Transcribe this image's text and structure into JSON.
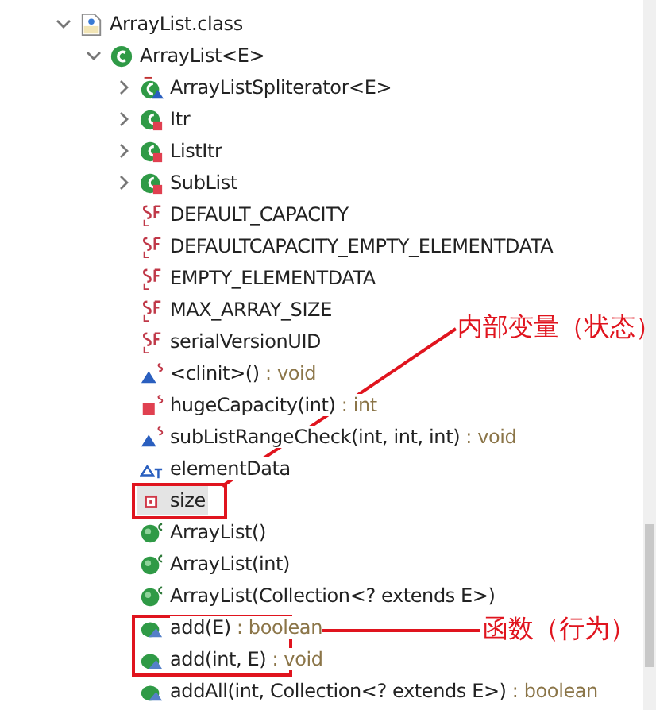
{
  "tree": [
    {
      "label": "ArrayList.class",
      "kind": "classfile",
      "expanded": true,
      "selected": false,
      "children": [
        {
          "label": "ArrayList<E>",
          "kind": "class",
          "expanded": true,
          "selected": false,
          "children": [
            {
              "label": "ArrayListSpliterator<E>",
              "kind": "static-class",
              "expanded": false,
              "selected": false
            },
            {
              "label": "Itr",
              "kind": "private-class",
              "expanded": false,
              "selected": false
            },
            {
              "label": "ListItr",
              "kind": "private-class",
              "expanded": false,
              "selected": false
            },
            {
              "label": "SubList",
              "kind": "private-class",
              "expanded": false,
              "selected": false
            },
            {
              "label": "DEFAULT_CAPACITY",
              "kind": "constant",
              "selected": false
            },
            {
              "label": "DEFAULTCAPACITY_EMPTY_ELEMENTDATA",
              "kind": "constant",
              "selected": false
            },
            {
              "label": "EMPTY_ELEMENTDATA",
              "kind": "constant",
              "selected": false
            },
            {
              "label": "MAX_ARRAY_SIZE",
              "kind": "constant",
              "selected": false
            },
            {
              "label": "serialVersionUID",
              "kind": "constant",
              "selected": false
            },
            {
              "label": "<clinit>()",
              "type": " : void",
              "kind": "static-method",
              "selected": false
            },
            {
              "label": "hugeCapacity(int)",
              "type": " : int",
              "kind": "static-private-method",
              "selected": false
            },
            {
              "label": "subListRangeCheck(int, int, int)",
              "type": " : void",
              "kind": "static-method",
              "selected": false
            },
            {
              "label": "elementData",
              "kind": "transient-field",
              "selected": false
            },
            {
              "label": "size",
              "kind": "private-field",
              "selected": true
            },
            {
              "label": "ArrayList()",
              "kind": "constructor",
              "selected": false
            },
            {
              "label": "ArrayList(int)",
              "kind": "constructor",
              "selected": false
            },
            {
              "label": "ArrayList(Collection<? extends E>)",
              "kind": "constructor",
              "selected": false
            },
            {
              "label": "add(E)",
              "type": " : boolean",
              "kind": "method",
              "selected": false
            },
            {
              "label": "add(int, E)",
              "type": " : void",
              "kind": "method",
              "selected": false
            },
            {
              "label": "addAll(int, Collection<? extends E>)",
              "type": " : boolean",
              "kind": "method",
              "selected": false
            }
          ]
        }
      ]
    }
  ],
  "annotations": [
    {
      "text": "内部变量（状态）"
    },
    {
      "text": "函数（行为）"
    }
  ]
}
